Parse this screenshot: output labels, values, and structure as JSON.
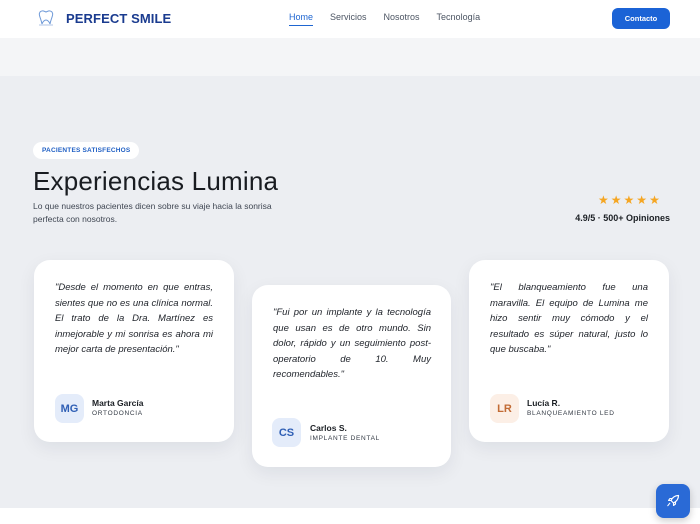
{
  "nav": {
    "brand": "PERFECT SMILE",
    "links": [
      {
        "label": "Home",
        "active": true
      },
      {
        "label": "Servicios",
        "active": false
      },
      {
        "label": "Nosotros",
        "active": false
      },
      {
        "label": "Tecnología",
        "active": false
      }
    ],
    "contact_label": "Contacto"
  },
  "testimonials": {
    "badge": "PACIENTES SATISFECHOS",
    "title": "Experiencias Lumina",
    "subtitle": "Lo que nuestros pacientes dicen sobre su viaje hacia la sonrisa perfecta con nosotros.",
    "stars": 5,
    "rating_text": "4.9/5 · 500+ Opiniones",
    "cards": [
      {
        "quote": "\"Desde el momento en que entras, sientes que no es una clínica normal. El trato de la Dra. Martínez es inmejorable y mi sonrisa es ahora mi mejor carta de presentación.\"",
        "initials": "MG",
        "name": "Marta García",
        "role": "ORTODONCIA"
      },
      {
        "quote": "\"Fui por un implante y la tecnología que usan es de otro mundo. Sin dolor, rápido y un seguimiento post-operatorio de 10. Muy recomendables.\"",
        "initials": "CS",
        "name": "Carlos S.",
        "role": "IMPLANTE DENTAL"
      },
      {
        "quote": "\"El blanqueamiento fue una maravilla. El equipo de Lumina me hizo sentir muy cómodo y el resultado es súper natural, justo lo que buscaba.\"",
        "initials": "LR",
        "name": "Lucía R.",
        "role": "BLANQUEAMIENTO LED"
      }
    ]
  },
  "colors": {
    "brand": "#1a3b8f",
    "accent": "#1b63d6",
    "star": "#f5a623"
  },
  "icons": {
    "logo": "tooth-logo-icon",
    "fab": "rocket-icon"
  }
}
